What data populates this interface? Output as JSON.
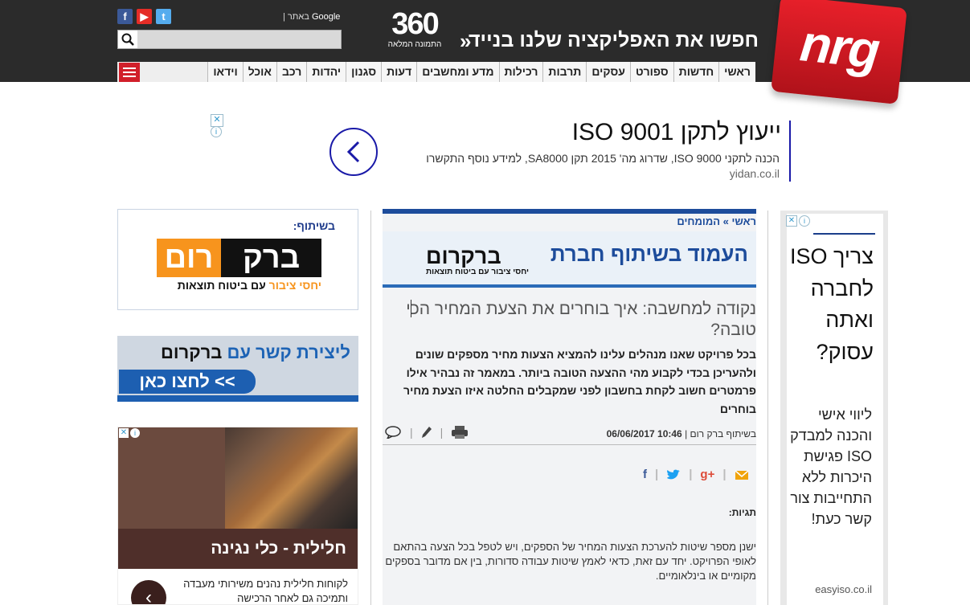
{
  "header": {
    "logo": "nrg",
    "promo": "חפשו את האפליקציה שלנו בנייד",
    "promo_arrow": "»",
    "logo360_big": "360",
    "logo360_small": "התמונה המלאה",
    "google_label": "Google",
    "google_sep": "| באתר",
    "search_placeholder": ""
  },
  "nav": {
    "items": [
      "ראשי",
      "חדשות",
      "ספורט",
      "עסקים",
      "תרבות",
      "רכילות",
      "מדע ומחשבים",
      "דעות",
      "סגנון",
      "יהדות",
      "רכב",
      "אוכל",
      "וידאו"
    ]
  },
  "top_ad": {
    "title": "ייעוץ לתקן ISO 9001",
    "description": "הכנה לתקני ISO 9000, שדרוג מה' 2015 תקן SA8000, למידע נוסף התקשרו",
    "url": "yidan.co.il",
    "close": "✕",
    "info": "i"
  },
  "left": {
    "collab_label": "בשיתוף:",
    "logo_orange": "רום",
    "logo_dark": "ברק",
    "logo_sub_orange": "יחסי ציבור",
    "logo_sub_dark": " עם ביטוח תוצאות",
    "contact_text": "ליצירת קשר עם",
    "contact_brand": "ברקרום",
    "contact_button": "לחצו כאן <<",
    "ad2_title": "חלילית - כלי נגינה",
    "ad2_text": "לקוחות חלילית נהנים משירותי מעבדה ותמיכה גם לאחר הרכישה"
  },
  "article": {
    "breadcrumb": "ראשי » המומחים",
    "editorial_title": "העמוד בשיתוף חברת",
    "editorial_logo": "ברקרום",
    "editorial_logo_sub": "יחסי ציבור עם ביטוח תוצאות",
    "headline": "נקודה למחשבה: איך בוחרים את הצעת המחיר הכי טובה?",
    "summary": "בכל פרויקט שאנו מנהלים עלינו להמציא הצעות מחיר מספקים שונים ולהעריכן בכדי לקבוע מהי ההצעה הטובה ביותר. במאמר זה נבהיר אילו פרמטרים חשוב לקחת בחשבון לפני שמקבלים החלטה איזו הצעת מחיר בוחרים",
    "meta_author": "בשיתוף ברק רום",
    "meta_sep": " | ",
    "meta_date": "10:46 06/06/2017",
    "tags_label": "תגיות:",
    "body": "ישנן מספר שיטות להערכת הצעות המחיר של הספקים, ויש לטפל בכל הצעה בהתאם לאופי הפרויקט. יחד עם זאת,  כדאי לאמץ שיטות עבודה סדורות, בין אם מדובר בספקים מקומיים או בינלאומיים."
  },
  "right_ad": {
    "title": "צריך ISO לחברה ואתה עסוק?",
    "text": "ליווי אישי והכנה למבדק ISO פגישת היכרות ללא התחייבות צור קשר כעת!",
    "url": "easyiso.co.il"
  },
  "colors": {
    "brand_red": "#d11f2a",
    "header_dark": "#2b2b2b",
    "article_blue": "#1d4c9b",
    "barkrom_orange": "#f7941d"
  }
}
